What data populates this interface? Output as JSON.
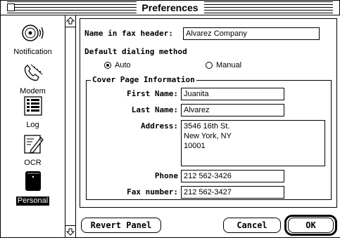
{
  "window": {
    "title": "Preferences"
  },
  "sidebar": {
    "items": [
      {
        "label": "Notification",
        "icon": "speaker-icon",
        "selected": false
      },
      {
        "label": "Modem",
        "icon": "telephone-icon",
        "selected": false
      },
      {
        "label": "Log",
        "icon": "log-list-icon",
        "selected": false
      },
      {
        "label": "OCR",
        "icon": "ocr-pencil-icon",
        "selected": false
      },
      {
        "label": "Personal",
        "icon": "personal-book-icon",
        "selected": true
      }
    ]
  },
  "form": {
    "fax_header_label": "Name in fax header:",
    "fax_header_value": "Alvarez Company",
    "dialing_label": "Default dialing method",
    "dialing_options": [
      {
        "label": "Auto",
        "selected": true
      },
      {
        "label": "Manual",
        "selected": false
      }
    ],
    "cover_group_title": "Cover Page Information",
    "first_name_label": "First Name:",
    "first_name_value": "Juanita",
    "last_name_label": "Last Name:",
    "last_name_value": "Alvarez",
    "address_label": "Address:",
    "address_value": "3546 16th St.\nNew York, NY\n10001",
    "phone_label": "Phone",
    "phone_value": "212 562-3426",
    "fax_label": "Fax number:",
    "fax_value": "212 562-3427"
  },
  "buttons": {
    "revert": "Revert Panel",
    "cancel": "Cancel",
    "ok": "OK"
  }
}
